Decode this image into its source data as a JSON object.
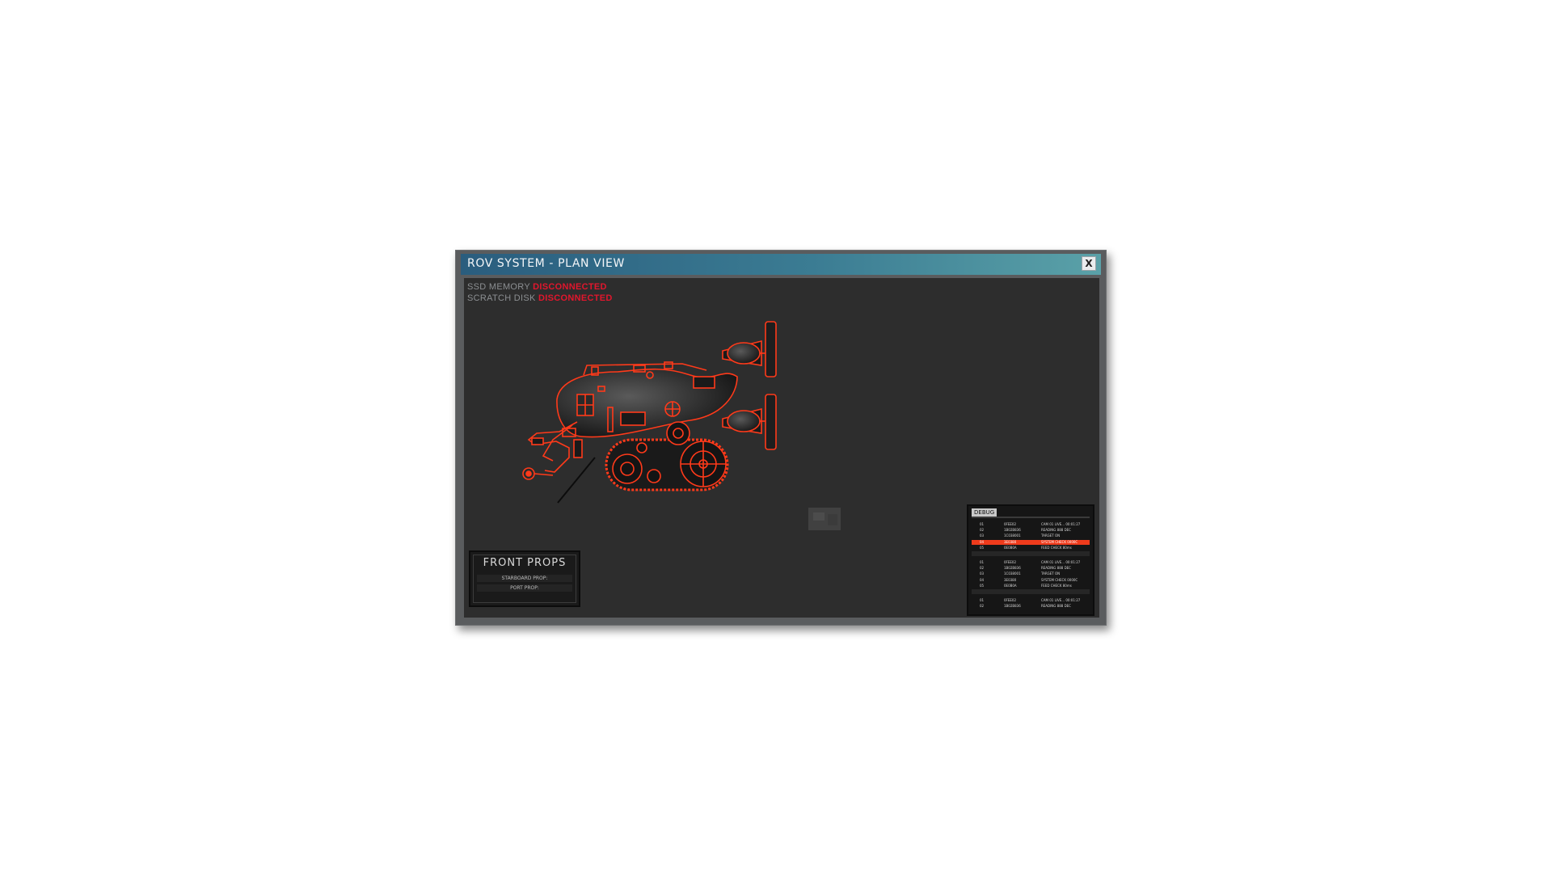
{
  "window": {
    "title": "ROV SYSTEM - PLAN VIEW",
    "close_label": "X"
  },
  "status": [
    {
      "label": "SSD MEMORY",
      "value": "DISCONNECTED"
    },
    {
      "label": "SCRATCH DISK",
      "value": "DISCONNECTED"
    }
  ],
  "colors": {
    "wireframe": "#ff3a1a",
    "alert": "#e2162d",
    "debug_highlight": "#ef3b1c",
    "title_gradient_start": "#2a5d7e",
    "title_gradient_end": "#5aa1a8"
  },
  "front_props": {
    "title": "FRONT PROPS",
    "rows": [
      "STARBOARD PROP:",
      "PORT PROP:"
    ]
  },
  "debug": {
    "tab_label": "DEBUG",
    "rows": [
      {
        "id": "01",
        "code": "0FEE02",
        "msg": "CAM 01 LIVE... 00:01:27",
        "style": "normal"
      },
      {
        "id": "02",
        "code": "1B02B836",
        "msg": "READING 888 DEC",
        "style": "normal"
      },
      {
        "id": "03",
        "code": "1C038001",
        "msg": "TARGET ON",
        "style": "normal"
      },
      {
        "id": "04",
        "code": "3E0380",
        "msg": "SYSTEM CHECK 0000C",
        "style": "highlight"
      },
      {
        "id": "05",
        "code": "0E0B0A",
        "msg": "FEED CHECK 80ms",
        "style": "normal"
      },
      {
        "id": "",
        "code": "",
        "msg": "",
        "style": "separator"
      },
      {
        "id": "01",
        "code": "0FEE02",
        "msg": "CAM 01 LIVE... 00:01:27",
        "style": "normal"
      },
      {
        "id": "02",
        "code": "1B02B836",
        "msg": "READING 888 DEC",
        "style": "normal"
      },
      {
        "id": "03",
        "code": "1C038001",
        "msg": "TARGET ON",
        "style": "normal"
      },
      {
        "id": "04",
        "code": "3E0380",
        "msg": "SYSTEM CHECK 0000C",
        "style": "normal"
      },
      {
        "id": "05",
        "code": "0E0B0A",
        "msg": "FEED CHECK 80ms",
        "style": "normal"
      },
      {
        "id": "",
        "code": "",
        "msg": "",
        "style": "separator"
      },
      {
        "id": "01",
        "code": "0FEE02",
        "msg": "CAM 01 LIVE... 00:01:27",
        "style": "normal"
      },
      {
        "id": "02",
        "code": "1B02B836",
        "msg": "READING 888 DEC",
        "style": "normal"
      }
    ]
  }
}
